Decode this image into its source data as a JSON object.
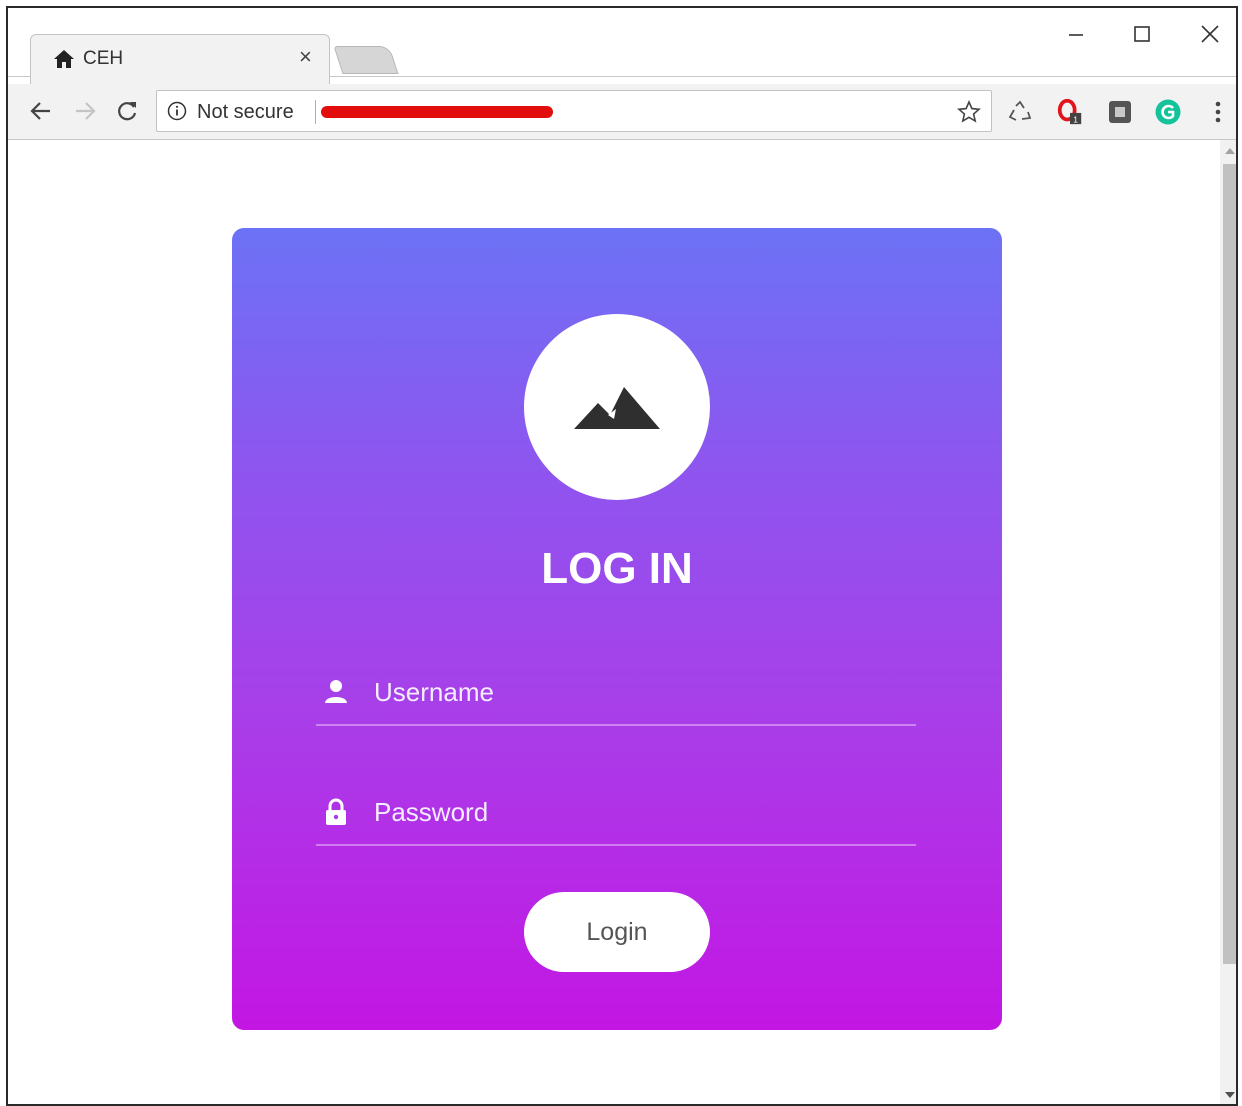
{
  "browser": {
    "tab_title": "CEH",
    "tab_close": "×",
    "security_label": "Not secure",
    "url_redaction_color": "#e20d0d"
  },
  "login": {
    "title": "LOG IN",
    "username_placeholder": "Username",
    "password_placeholder": "Password",
    "button_label": "Login",
    "gradient_top": "#6c72f5",
    "gradient_bottom": "#c316e3"
  },
  "icons": {
    "tab": "home-icon",
    "toolbar": [
      "back-arrow-icon",
      "forward-arrow-icon",
      "reload-icon",
      "info-icon",
      "star-icon"
    ],
    "extensions": [
      "recycle-icon",
      "opera-icon",
      "square-extension-icon",
      "grammarly-icon",
      "kebab-menu-icon"
    ],
    "logo": "mountain-icon",
    "fields": [
      "user-icon",
      "lock-icon"
    ]
  }
}
